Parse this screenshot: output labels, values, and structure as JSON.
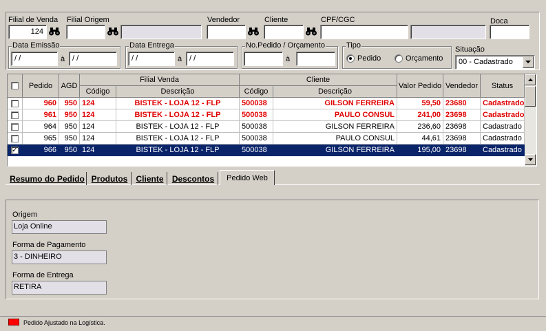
{
  "filters": {
    "filial_venda": {
      "label": "Filial de Venda",
      "value": "124"
    },
    "filial_origem": {
      "label": "Filial Origem",
      "value": "",
      "desc": ""
    },
    "vendedor": {
      "label": "Vendedor",
      "value": ""
    },
    "cliente": {
      "label": "Cliente",
      "value": ""
    },
    "cpf_cgc": {
      "label": "CPF/CGC",
      "value": "",
      "desc": ""
    },
    "doca": {
      "label": "Doca",
      "value": ""
    },
    "data_emissao": {
      "label": "Data Emissão",
      "from": " / /",
      "to": " / /",
      "sep": "à"
    },
    "data_entrega": {
      "label": "Data Entrega",
      "from": " / /",
      "to": " / /",
      "sep": "à"
    },
    "pedido_orcamento": {
      "label": "No.Pedido / Orçamento",
      "from": "",
      "to": "",
      "sep": "à"
    },
    "tipo": {
      "label": "Tipo",
      "options": [
        "Pedido",
        "Orçamento"
      ],
      "selected": "Pedido"
    },
    "situacao": {
      "label": "Situação",
      "value": "00 - Cadastrado"
    }
  },
  "grid": {
    "headers": {
      "pedido": "Pedido",
      "agd": "AGD",
      "filial_venda": "Filial Venda",
      "cliente": "Cliente",
      "codigo": "Código",
      "descricao": "Descrição",
      "valor": "Valor Pedido",
      "vendedor": "Vendedor",
      "status": "Status"
    },
    "rows": [
      {
        "checked": false,
        "pedido": "960",
        "agd": "950",
        "fil_cod": "124",
        "fil_desc": "BISTEK - LOJA 12 - FLP",
        "cli_cod": "500038",
        "cli_desc": "GILSON FERREIRA",
        "valor": "59,50",
        "vendedor": "23680",
        "status": "Cadastrado",
        "highlight": "red"
      },
      {
        "checked": false,
        "pedido": "961",
        "agd": "950",
        "fil_cod": "124",
        "fil_desc": "BISTEK - LOJA 12 - FLP",
        "cli_cod": "500038",
        "cli_desc": "PAULO CONSUL",
        "valor": "241,00",
        "vendedor": "23698",
        "status": "Cadastrado",
        "highlight": "red"
      },
      {
        "checked": false,
        "pedido": "964",
        "agd": "950",
        "fil_cod": "124",
        "fil_desc": "BISTEK - LOJA 12 - FLP",
        "cli_cod": "500038",
        "cli_desc": "GILSON FERREIRA",
        "valor": "236,60",
        "vendedor": "23698",
        "status": "Cadastrado",
        "highlight": "none"
      },
      {
        "checked": false,
        "pedido": "965",
        "agd": "950",
        "fil_cod": "124",
        "fil_desc": "BISTEK - LOJA 12 - FLP",
        "cli_cod": "500038",
        "cli_desc": "PAULO CONSUL",
        "valor": "44,61",
        "vendedor": "23698",
        "status": "Cadastrado",
        "highlight": "none"
      },
      {
        "checked": true,
        "pedido": "966",
        "agd": "950",
        "fil_cod": "124",
        "fil_desc": "BISTEK - LOJA 12 - FLP",
        "cli_cod": "500038",
        "cli_desc": "GILSON FERREIRA",
        "valor": "195,00",
        "vendedor": "23698",
        "status": "Cadastrado",
        "highlight": "selected"
      }
    ]
  },
  "tabs": [
    {
      "label": "Resumo do Pedido",
      "active": false
    },
    {
      "label": "Produtos",
      "active": false
    },
    {
      "label": "Cliente",
      "active": false
    },
    {
      "label": "Descontos",
      "active": false
    },
    {
      "label": "Pedido Web",
      "active": true
    }
  ],
  "pedido_web": {
    "origem": {
      "label": "Origem",
      "value": "Loja Online"
    },
    "forma_pagamento": {
      "label": "Forma de Pagamento",
      "value": "3 - DINHEIRO"
    },
    "forma_entrega": {
      "label": "Forma de Entrega",
      "value": "RETIRA"
    }
  },
  "legend": {
    "text": "Pedido Ajustado na Logística.",
    "color": "#ff0000"
  },
  "colors": {
    "selected_row": "#0a246a",
    "highlight_text": "#e00000"
  }
}
